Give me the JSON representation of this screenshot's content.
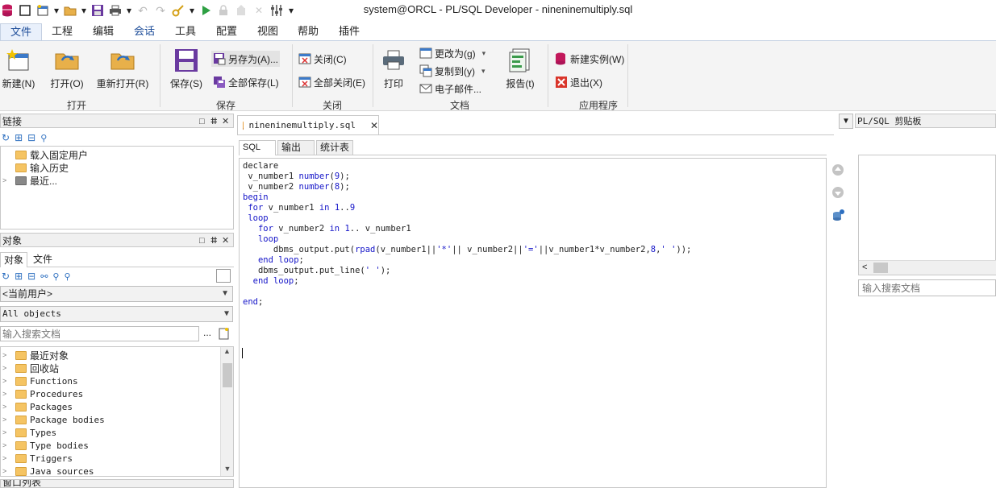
{
  "window": {
    "title": "system@ORCL - PL/SQL Developer - nineninemultiply.sql"
  },
  "ribbon_tabs": [
    "文件",
    "工程",
    "编辑",
    "会话",
    "工具",
    "配置",
    "视图",
    "帮助",
    "插件"
  ],
  "ribbon": {
    "open_group": {
      "label": "打开",
      "new": "新建(N)",
      "open": "打开(O)",
      "reopen": "重新打开(R)"
    },
    "save_group": {
      "label": "保存",
      "save": "保存(S)",
      "save_as": "另存为(A)...",
      "save_all": "全部保存(L)"
    },
    "close_group": {
      "label": "关闭",
      "close": "关闭(C)",
      "close_all": "全部关闭(E)"
    },
    "doc_group": {
      "label": "文档",
      "print": "打印",
      "change_to": "更改为(g)",
      "copy_to": "复制到(y)",
      "email": "电子邮件...",
      "report": "报告(t)"
    },
    "app_group": {
      "label": "应用程序",
      "new_instance": "新建实例(W)",
      "exit": "退出(X)"
    }
  },
  "connections_panel": {
    "title": "链接",
    "items": [
      "载入固定用户",
      "输入历史",
      "最近..."
    ]
  },
  "objects_panel": {
    "title": "对象",
    "tabs": [
      "对象",
      "文件"
    ],
    "user_combo": "<当前用户>",
    "objects_combo": "All objects",
    "search_placeholder": "输入搜索文档",
    "more": "...",
    "tree": [
      "最近对象",
      "回收站",
      "Functions",
      "Procedures",
      "Packages",
      "Package bodies",
      "Types",
      "Type bodies",
      "Triggers",
      "Java sources"
    ]
  },
  "window_list_panel": {
    "title": "窗口列表"
  },
  "editor": {
    "tab_title": "nineninemultiply.sql",
    "sub_tabs": [
      "SQL",
      "输出",
      "统计表"
    ],
    "code_lines": [
      [
        [
          "t",
          "declare"
        ]
      ],
      [
        [
          "t",
          " v_number1 "
        ],
        [
          "k",
          "number"
        ],
        [
          "t",
          "("
        ],
        [
          "n",
          "9"
        ],
        [
          "t",
          ");"
        ]
      ],
      [
        [
          "t",
          " v_number2 "
        ],
        [
          "k",
          "number"
        ],
        [
          "t",
          "("
        ],
        [
          "n",
          "8"
        ],
        [
          "t",
          ");"
        ]
      ],
      [
        [
          "k",
          "begin"
        ]
      ],
      [
        [
          "t",
          " "
        ],
        [
          "k",
          "for"
        ],
        [
          "t",
          " v_number1 "
        ],
        [
          "k",
          "in"
        ],
        [
          "t",
          " "
        ],
        [
          "n",
          "1"
        ],
        [
          "t",
          ".."
        ],
        [
          "n",
          "9"
        ]
      ],
      [
        [
          "t",
          " "
        ],
        [
          "k",
          "loop"
        ]
      ],
      [
        [
          "t",
          "   "
        ],
        [
          "k",
          "for"
        ],
        [
          "t",
          " v_number2 "
        ],
        [
          "k",
          "in"
        ],
        [
          "t",
          " "
        ],
        [
          "n",
          "1"
        ],
        [
          "t",
          ".. v_number1"
        ]
      ],
      [
        [
          "t",
          "   "
        ],
        [
          "k",
          "loop"
        ]
      ],
      [
        [
          "t",
          "      dbms_output.put("
        ],
        [
          "k",
          "rpad"
        ],
        [
          "t",
          "(v_number1||"
        ],
        [
          "s",
          "'*'"
        ],
        [
          "t",
          "|| v_number2||"
        ],
        [
          "s",
          "'='"
        ],
        [
          "t",
          "||v_number1*v_number2,"
        ],
        [
          "n",
          "8"
        ],
        [
          "t",
          ","
        ],
        [
          "s",
          "' '"
        ],
        [
          "t",
          "));"
        ]
      ],
      [
        [
          "t",
          "   "
        ],
        [
          "k",
          "end loop"
        ],
        [
          "t",
          ";"
        ]
      ],
      [
        [
          "t",
          "   dbms_output.put_line("
        ],
        [
          "s",
          "' '"
        ],
        [
          "t",
          ");"
        ]
      ],
      [
        [
          "t",
          "  "
        ],
        [
          "k",
          "end loop"
        ],
        [
          "t",
          ";"
        ]
      ],
      [
        [
          "t",
          ""
        ]
      ],
      [
        [
          "k",
          "end"
        ],
        [
          "t",
          ";"
        ]
      ]
    ]
  },
  "clipboard_panel": {
    "title": "PL/SQL 剪贴板",
    "search_placeholder": "输入搜索文档"
  }
}
